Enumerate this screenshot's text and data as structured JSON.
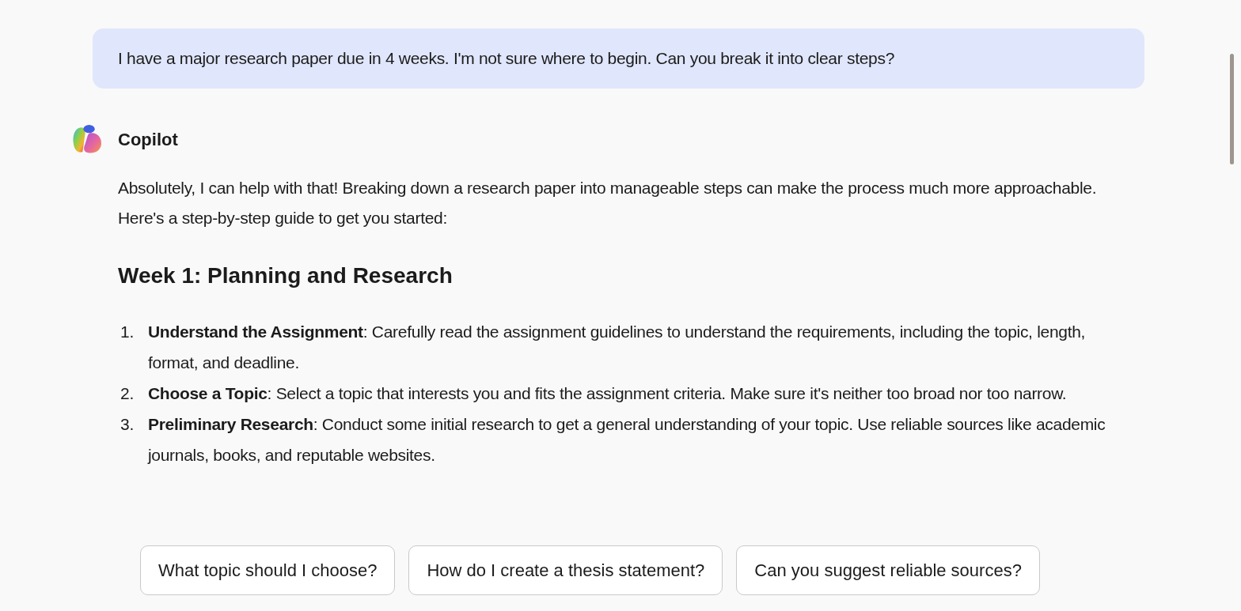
{
  "user_message": "I have a major research paper due in 4 weeks. I'm not sure where to begin. Can you break it into clear steps?",
  "assistant": {
    "name": "Copilot",
    "intro": "Absolutely, I can help with that! Breaking down a research paper into manageable steps can make the process much more approachable. Here's a step-by-step guide to get you started:",
    "heading": "Week 1: Planning and Research",
    "steps": [
      {
        "number": "1.",
        "text": "**Understand the Assignment**: Carefully read the assignment guidelines to understand the requirements, including the topic, length, format, and deadline."
      },
      {
        "number": "2.",
        "text": "**Choose a Topic**: Select a topic that interests you and fits the assignment criteria. Make sure it's neither too broad nor too narrow."
      },
      {
        "number": "3.",
        "text": "**Preliminary Research**: Conduct some initial research to get a general understanding of your topic. Use reliable sources like academic journals, books, and reputable websites."
      }
    ]
  },
  "suggestions": [
    "What topic should I choose?",
    "How do I create a thesis statement?",
    "Can you suggest reliable sources?"
  ]
}
